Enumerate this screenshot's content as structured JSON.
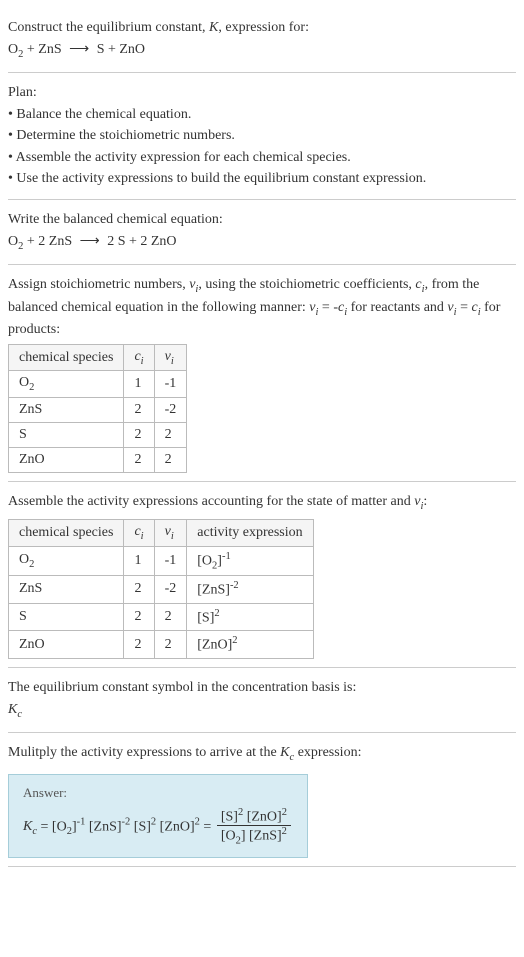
{
  "intro": {
    "line1": "Construct the equilibrium constant, K, expression for:",
    "equation": "O₂ + ZnS ⟶ S + ZnO"
  },
  "plan": {
    "heading": "Plan:",
    "items": [
      "• Balance the chemical equation.",
      "• Determine the stoichiometric numbers.",
      "• Assemble the activity expression for each chemical species.",
      "• Use the activity expressions to build the equilibrium constant expression."
    ]
  },
  "balanced": {
    "heading": "Write the balanced chemical equation:",
    "equation": "O₂ + 2 ZnS ⟶ 2 S + 2 ZnO"
  },
  "stoich": {
    "text1": "Assign stoichiometric numbers, νᵢ, using the stoichiometric coefficients, cᵢ, from the balanced chemical equation in the following manner: νᵢ = -cᵢ for reactants and νᵢ = cᵢ for products:",
    "headers": [
      "chemical species",
      "cᵢ",
      "νᵢ"
    ],
    "rows": [
      [
        "O₂",
        "1",
        "-1"
      ],
      [
        "ZnS",
        "2",
        "-2"
      ],
      [
        "S",
        "2",
        "2"
      ],
      [
        "ZnO",
        "2",
        "2"
      ]
    ]
  },
  "activity": {
    "heading": "Assemble the activity expressions accounting for the state of matter and νᵢ:",
    "headers": [
      "chemical species",
      "cᵢ",
      "νᵢ",
      "activity expression"
    ],
    "rows": [
      [
        "O₂",
        "1",
        "-1",
        "[O₂]⁻¹"
      ],
      [
        "ZnS",
        "2",
        "-2",
        "[ZnS]⁻²"
      ],
      [
        "S",
        "2",
        "2",
        "[S]²"
      ],
      [
        "ZnO",
        "2",
        "2",
        "[ZnO]²"
      ]
    ]
  },
  "kcsymbol": {
    "line1": "The equilibrium constant symbol in the concentration basis is:",
    "line2": "K_c"
  },
  "final": {
    "heading": "Mulitply the activity expressions to arrive at the K_c expression:",
    "answer_label": "Answer:",
    "expr_left": "K_c = [O₂]⁻¹ [ZnS]⁻² [S]² [ZnO]² =",
    "frac_num": "[S]² [ZnO]²",
    "frac_den": "[O₂] [ZnS]²"
  },
  "chart_data": {
    "type": "table",
    "title": "Stoichiometric and activity data",
    "tables": [
      {
        "headers": [
          "chemical species",
          "c_i",
          "nu_i"
        ],
        "rows": [
          {
            "species": "O2",
            "c_i": 1,
            "nu_i": -1
          },
          {
            "species": "ZnS",
            "c_i": 2,
            "nu_i": -2
          },
          {
            "species": "S",
            "c_i": 2,
            "nu_i": 2
          },
          {
            "species": "ZnO",
            "c_i": 2,
            "nu_i": 2
          }
        ]
      },
      {
        "headers": [
          "chemical species",
          "c_i",
          "nu_i",
          "activity expression"
        ],
        "rows": [
          {
            "species": "O2",
            "c_i": 1,
            "nu_i": -1,
            "activity": "[O2]^-1"
          },
          {
            "species": "ZnS",
            "c_i": 2,
            "nu_i": -2,
            "activity": "[ZnS]^-2"
          },
          {
            "species": "S",
            "c_i": 2,
            "nu_i": 2,
            "activity": "[S]^2"
          },
          {
            "species": "ZnO",
            "c_i": 2,
            "nu_i": 2,
            "activity": "[ZnO]^2"
          }
        ]
      }
    ]
  }
}
